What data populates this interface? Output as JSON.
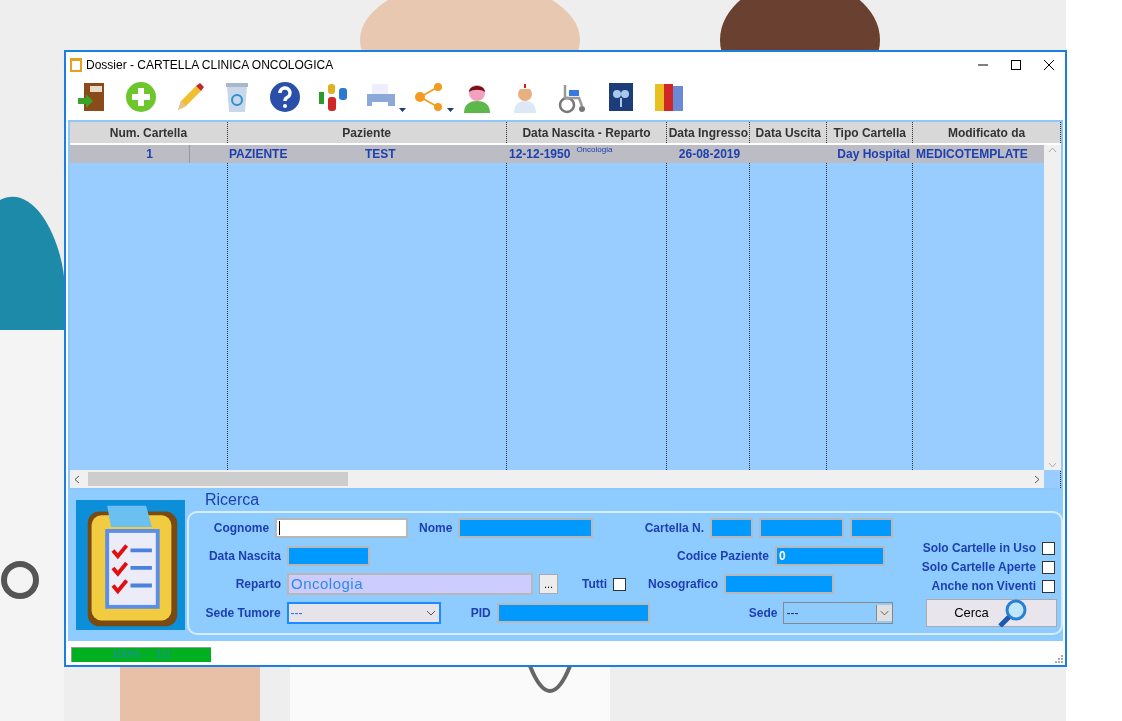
{
  "window": {
    "title": "Dossier - CARTELLA CLINICA ONCOLOGICA"
  },
  "table": {
    "columns": [
      "Num. Cartella",
      "Paziente",
      "Data Nascita - Reparto",
      "Data Ingresso",
      "Data Uscita",
      "Tipo Cartella",
      "Modificato da"
    ],
    "rows": [
      {
        "num": "1",
        "cognome": "PAZIENTE",
        "nome": "TEST",
        "data_nascita": "12-12-1950",
        "reparto": "Oncologia",
        "data_ingresso": "26-08-2019",
        "tipo": "Day Hospital",
        "modificato_da": "MEDICOTEMPLATE",
        "selected": true
      }
    ]
  },
  "search": {
    "title": "Ricerca",
    "cognome": {
      "label": "Cognome"
    },
    "nome": {
      "label": "Nome"
    },
    "data_nascita": {
      "label": "Data Nascita"
    },
    "reparto": {
      "label": "Reparto",
      "value": "Oncologia",
      "browse": "..."
    },
    "tutti": {
      "label": "Tutti",
      "checked": false
    },
    "sede_tumore": {
      "label": "Sede Tumore",
      "value": "---"
    },
    "pid": {
      "label": "PID"
    },
    "cartella_n": {
      "label": "Cartella N."
    },
    "codice_paziente": {
      "label": "Codice Paziente",
      "value": "0"
    },
    "nosografico": {
      "label": "Nosografico"
    },
    "sede": {
      "label": "Sede",
      "value": "---"
    },
    "options": [
      {
        "label": "Solo Cartelle in Uso",
        "checked": false
      },
      {
        "label": "Solo Cartelle Aperte",
        "checked": false
      },
      {
        "label": "Anche non Viventi",
        "checked": false
      }
    ],
    "button": "Cerca"
  },
  "status_bar": {
    "progress": {
      "level": 1,
      "text": "100%  -  1/1"
    }
  }
}
